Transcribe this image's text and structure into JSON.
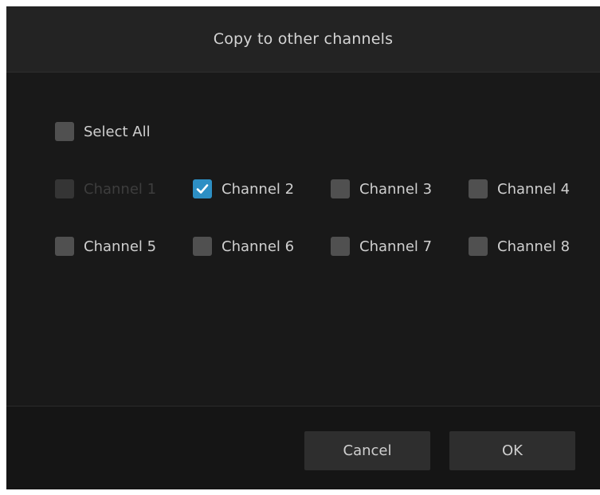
{
  "dialog": {
    "title": "Copy to other channels",
    "select_all": {
      "label": "Select All",
      "checked": false
    },
    "channels": [
      {
        "label": "Channel 1",
        "checked": false,
        "disabled": true
      },
      {
        "label": "Channel 2",
        "checked": true,
        "disabled": false
      },
      {
        "label": "Channel 3",
        "checked": false,
        "disabled": false
      },
      {
        "label": "Channel 4",
        "checked": false,
        "disabled": false
      },
      {
        "label": "Channel 5",
        "checked": false,
        "disabled": false
      },
      {
        "label": "Channel 6",
        "checked": false,
        "disabled": false
      },
      {
        "label": "Channel 7",
        "checked": false,
        "disabled": false
      },
      {
        "label": "Channel 8",
        "checked": false,
        "disabled": false
      }
    ],
    "buttons": {
      "cancel_label": "Cancel",
      "ok_label": "OK"
    }
  },
  "colors": {
    "dialog_bg": "#191919",
    "header_bg": "#232323",
    "checkbox_unchecked": "#505050",
    "checkbox_checked": "#2d8fc4",
    "checkbox_disabled": "#353535",
    "text": "#cfcfcf",
    "text_disabled": "#3d3d3d"
  },
  "icons": {
    "checkmark": "checkmark-icon"
  }
}
